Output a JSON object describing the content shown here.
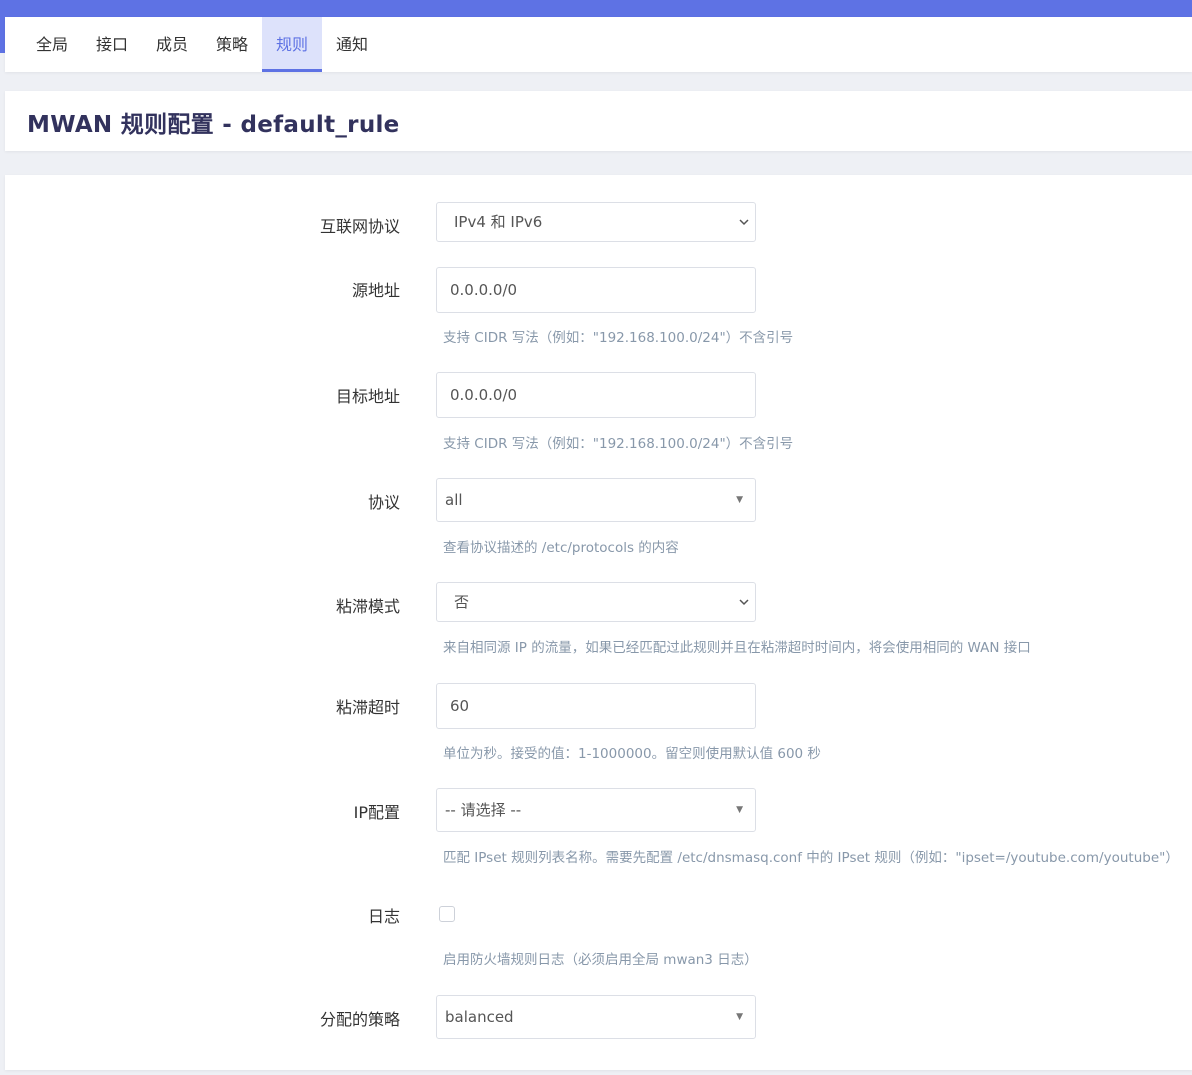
{
  "tabs": [
    {
      "label": "全局"
    },
    {
      "label": "接口"
    },
    {
      "label": "成员"
    },
    {
      "label": "策略"
    },
    {
      "label": "规则"
    },
    {
      "label": "通知"
    }
  ],
  "active_tab": "规则",
  "page_title": "MWAN 规则配置 - default_rule",
  "form": {
    "family": {
      "label": "互联网协议",
      "value": "IPv4 和 IPv6"
    },
    "src_ip": {
      "label": "源地址",
      "value": "0.0.0.0/0",
      "help": "支持 CIDR 写法（例如：\"192.168.100.0/24\"）不含引号"
    },
    "dest_ip": {
      "label": "目标地址",
      "value": "0.0.0.0/0",
      "help": "支持 CIDR 写法（例如：\"192.168.100.0/24\"）不含引号"
    },
    "proto": {
      "label": "协议",
      "value": "all",
      "help": "查看协议描述的 /etc/protocols 的内容"
    },
    "sticky": {
      "label": "粘滞模式",
      "value": "否",
      "help": "来自相同源 IP 的流量，如果已经匹配过此规则并且在粘滞超时时间内，将会使用相同的 WAN 接口"
    },
    "timeout": {
      "label": "粘滞超时",
      "value": "60",
      "help": "单位为秒。接受的值：1-1000000。留空则使用默认值 600 秒"
    },
    "ipset": {
      "label": "IP配置",
      "value": "-- 请选择 --",
      "help": "匹配 IPset 规则列表名称。需要先配置 /etc/dnsmasq.conf 中的 IPset 规则（例如：\"ipset=/youtube.com/youtube\"）"
    },
    "logging": {
      "label": "日志",
      "checked": false,
      "help": "启用防火墙规则日志（必须启用全局 mwan3 日志）"
    },
    "use_policy": {
      "label": "分配的策略",
      "value": "balanced"
    }
  },
  "colors": {
    "accent": "#5e72e4",
    "tab_active_bg": "#dde2fb",
    "title": "#32325d",
    "help_text": "#8898aa"
  }
}
